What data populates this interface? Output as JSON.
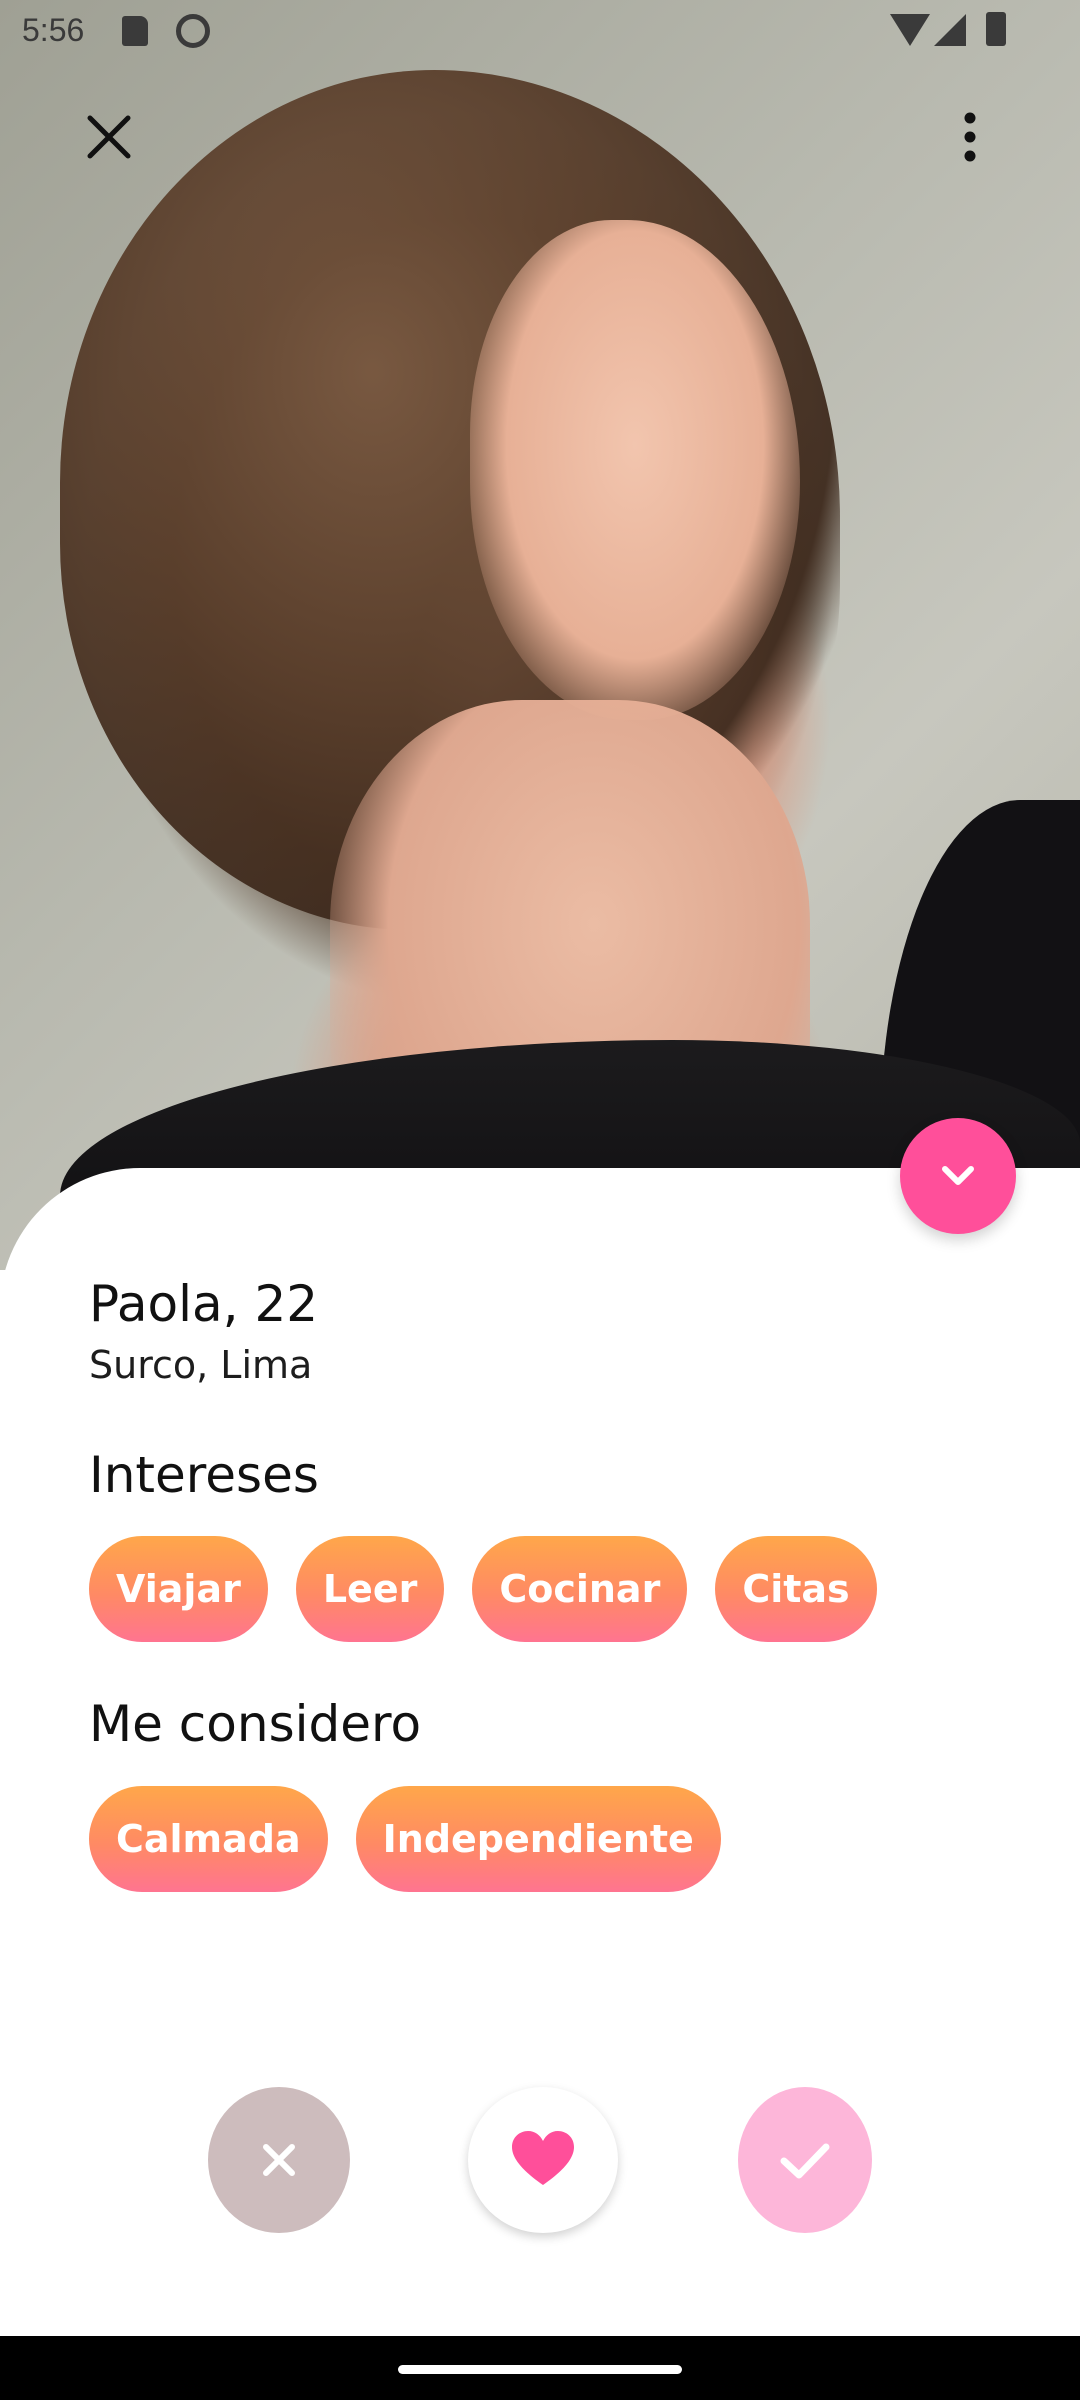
{
  "status_bar": {
    "time": "5:56"
  },
  "profile": {
    "name_age": "Paola, 22",
    "location": "Surco, Lima"
  },
  "interests": {
    "title": "Intereses",
    "chips": [
      "Viajar",
      "Leer",
      "Cocinar",
      "Citas"
    ]
  },
  "self_description": {
    "title": "Me considero",
    "chips": [
      "Calmada",
      "Independiente"
    ]
  },
  "icons": {
    "close": "close-icon",
    "more": "more-vertical-icon",
    "collapse": "chevron-down-icon",
    "dislike": "close-icon",
    "like": "heart-icon",
    "accept": "check-icon"
  },
  "colors": {
    "accent_pink": "#ff4f9a",
    "chip_gradient_start": "#ffa74a",
    "chip_gradient_end": "#ff7490",
    "dislike_bg": "#cdbcbd",
    "accept_bg": "#fdb6d9"
  }
}
